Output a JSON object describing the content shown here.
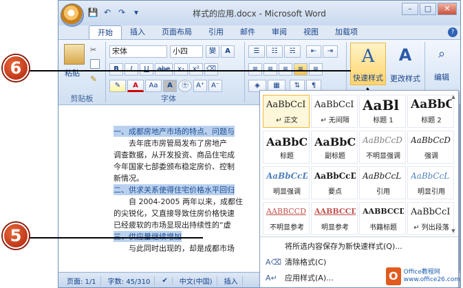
{
  "window": {
    "title": "样式的应用.docx - Microsoft Word",
    "controls": [
      "–",
      "□",
      "✕"
    ]
  },
  "qat": [
    {
      "icon": "save-icon",
      "glyph": "💾"
    },
    {
      "icon": "undo-icon",
      "glyph": "↶"
    },
    {
      "icon": "redo-icon",
      "glyph": "↷"
    },
    {
      "icon": "customize-icon",
      "glyph": "▾"
    }
  ],
  "tabs": [
    "开始",
    "插入",
    "页面布局",
    "引用",
    "邮件",
    "审阅",
    "视图",
    "加载项"
  ],
  "ribbon": {
    "clipboard": {
      "paste": "粘贴",
      "label": "剪贴板"
    },
    "font": {
      "name": "宋体",
      "size": "小四",
      "label": "字体",
      "buttons": [
        "B",
        "I",
        "U",
        "abe",
        "x₂",
        "x²",
        "A",
        "Aa",
        "A",
        "A⁺",
        "A⁻"
      ]
    },
    "styles": {
      "quick_styles": "快速样式",
      "change_styles": "更改样式"
    },
    "editing": {
      "label": "编辑"
    }
  },
  "document": {
    "lines": [
      {
        "text": "一、成都房地产市场的特点、问题与",
        "highlight": true
      },
      {
        "text": "　　去年底市房管局发布了房地产",
        "highlight": false
      },
      {
        "text": "调查数据，从开发投资、商品住宅成",
        "highlight": false
      },
      {
        "text": "今年国家七部委颁布稳定房价、控制",
        "highlight": false
      },
      {
        "text": "新情况。",
        "highlight": false
      },
      {
        "text": "二、供求关系使得住宅价格水平回归",
        "highlight": true
      },
      {
        "text": "　　自 2004-2005 两年以来，成都住",
        "highlight": false
      },
      {
        "text": "的尖锐化，又直接导致住房价格快速",
        "highlight": false
      },
      {
        "text": "已经疲软的市场显现出持续性的“虚",
        "highlight": false
      },
      {
        "text": "三、供应量继续增加",
        "highlight": true
      },
      {
        "text": "　　与此同时出现的，却是成都市场",
        "highlight": false
      }
    ]
  },
  "status": {
    "page": "页面: 1/1",
    "words": "字数: 45/310",
    "lang": "中文(中国)",
    "mode": "插入"
  },
  "gallery": {
    "styles": [
      {
        "sample": "AaBbCcI",
        "name": "↵ 正文"
      },
      {
        "sample": "AaBbCcI",
        "name": "↵ 无间隔"
      },
      {
        "sample": "AaBl",
        "name": "标题 1"
      },
      {
        "sample": "AaBbC",
        "name": "标题 2"
      },
      {
        "sample": "AaBbC",
        "name": "标题"
      },
      {
        "sample": "AaBbC",
        "name": "副标题"
      },
      {
        "sample": "AaBbCcD",
        "name": "不明显强调"
      },
      {
        "sample": "AaBbCcD",
        "name": "强调"
      },
      {
        "sample": "AaBbCcD",
        "name": "明显强调"
      },
      {
        "sample": "AaBbCcD",
        "name": "要点"
      },
      {
        "sample": "AaBbCcL",
        "name": "引用"
      },
      {
        "sample": "AaBbCcL",
        "name": "明显引用"
      },
      {
        "sample": "AABBCCD",
        "name": "不明显参考"
      },
      {
        "sample": "AABBCCD",
        "name": "明显参考"
      },
      {
        "sample": "AABBCCD",
        "name": "书籍标题"
      },
      {
        "sample": "AaBbCcI",
        "name": "↵ 列出段落"
      }
    ],
    "menu": [
      "将所选内容保存为新快速样式(Q)...",
      "清除格式(C)",
      "应用样式(A)..."
    ]
  },
  "callouts": [
    "6",
    "5"
  ],
  "watermark": {
    "logo": "O",
    "line1": "Office教程网",
    "line2": "www.office26.com"
  },
  "colors": {
    "ribbon": "#dfe8f5",
    "accent": "#15428b",
    "callout": "#c2321a",
    "highlight": "#b9d1ee"
  }
}
